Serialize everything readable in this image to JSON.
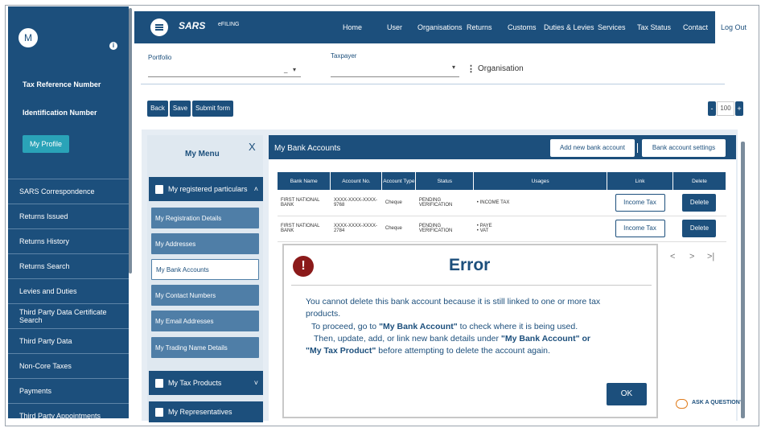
{
  "sidebar": {
    "avatar_initial": "M",
    "tax_reference_label": "Tax Reference Number",
    "identification_label": "Identification Number",
    "my_profile_button": "My Profile",
    "items": [
      "SARS Correspondence",
      "Returns Issued",
      "Returns History",
      "Returns Search",
      "Levies and Duties",
      "Third Party Data Certificate Search",
      "Third Party Data",
      "Non-Core Taxes",
      "Payments",
      "Third Party Appointments"
    ]
  },
  "header": {
    "logo": "SARS",
    "efiling": "eFILING",
    "nav": [
      "Home",
      "User",
      "Organisations",
      "Returns",
      "Customs",
      "Duties & Levies",
      "Services",
      "Tax Status",
      "Contact"
    ],
    "logout": "Log Out"
  },
  "filters": {
    "portfolio_label": "Portfolio",
    "portfolio_value": "_",
    "taxpayer_label": "Taxpayer",
    "organisation_label": "Organisation"
  },
  "actions": {
    "back": "Back",
    "save": "Save",
    "submit": "Submit form",
    "zoom_minus": "-",
    "zoom_value": "100",
    "zoom_plus": "+"
  },
  "menu": {
    "title": "My Menu",
    "close": "X",
    "registered_particulars": "My registered particulars",
    "sub_items": [
      "My Registration Details",
      "My Addresses",
      "My Bank Accounts",
      "My Contact Numbers",
      "My Email Addresses",
      "My Trading Name Details"
    ],
    "active_item": "My Bank Accounts",
    "tax_products": "My Tax Products",
    "representatives": "My Representatives"
  },
  "bank": {
    "title": "My Bank Accounts",
    "add_button": "Add new bank account",
    "settings_button": "Bank account settings",
    "columns": [
      "Bank Name",
      "Account No.",
      "Account Type",
      "Status",
      "Usages",
      "Link",
      "Delete"
    ],
    "rows": [
      {
        "bank_name": "FIRST NATIONAL BANK",
        "account_no": "XXXX-XXXX-XXXX-9768",
        "account_type": "Cheque",
        "status": "PENDING VERIFICATION",
        "usages": [
          "INCOME TAX"
        ],
        "link": "Income Tax",
        "delete": "Delete"
      },
      {
        "bank_name": "FIRST NATIONAL BANK",
        "account_no": "XXXX-XXXX-XXXX-2784",
        "account_type": "Cheque",
        "status": "PENDING VERIFICATION",
        "usages": [
          "PAYE",
          "VAT"
        ],
        "link": "Income Tax",
        "delete": "Delete"
      }
    ],
    "pager": [
      "<",
      ">",
      ">|"
    ]
  },
  "error_dialog": {
    "icon": "!",
    "title": "Error",
    "line1": "You cannot delete this bank account because it is still linked to one or more tax",
    "line2": "products.",
    "line3_pre": "To proceed, go to ",
    "line3_bold": "\"My Bank Account\"",
    "line3_post": " to check where it is being used.",
    "line4_pre": "Then, update, add, or link new bank details under ",
    "line4_bold": "\"My Bank Account\" or",
    "line5_bold": "\"My Tax Product\"",
    "line5_post": " before attempting to delete the account again.",
    "ok": "OK"
  },
  "help": {
    "ask": "ASK A QUESTION?"
  },
  "colors": {
    "primary": "#1c4f7c",
    "accent": "#2aa3b8",
    "error_icon": "#8b1a1a"
  }
}
